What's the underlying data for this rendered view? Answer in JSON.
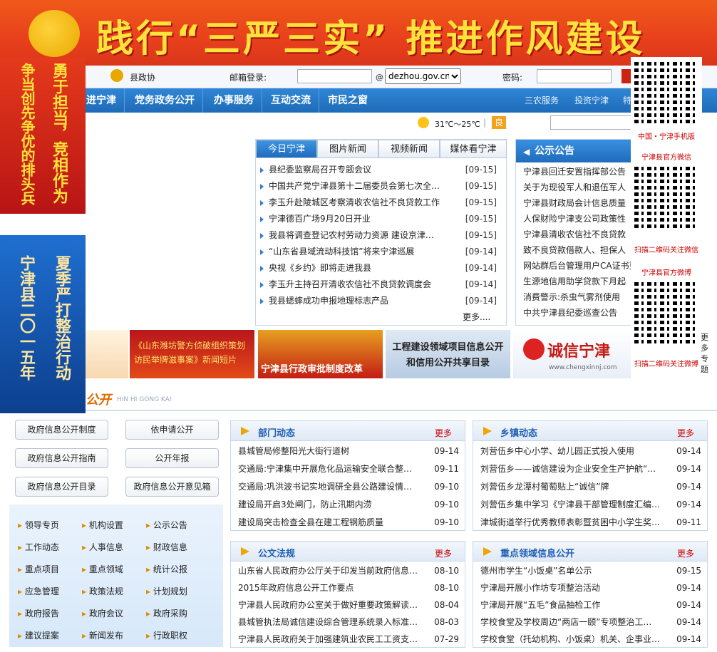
{
  "banner": {
    "title": "践行“三严三实” 推进作风建设"
  },
  "login": {
    "link_left": "县政协",
    "email_label": "邮箱登录:",
    "at": "@",
    "domain": "dezhou.gov.cn",
    "password_label": "密码:"
  },
  "nav": {
    "items": [
      "进宁津",
      "党务政务公开",
      "办事服务",
      "互动交流",
      "市民之窗"
    ],
    "right": [
      "三农服务",
      "投资宁津",
      "特"
    ]
  },
  "weather": {
    "temp": "31℃～25℃",
    "sep": "|",
    "quality": "良"
  },
  "left_ads": {
    "ad1_col1": "勇于担当，竞相作为",
    "ad1_col2": "争当创先争优的排头兵",
    "ad2_col1": "夏季严打整治行动",
    "ad2_col2": "宁津县二〇一五年"
  },
  "tabs": [
    "今日宁津",
    "图片新闻",
    "视频新闻",
    "媒体看宁津"
  ],
  "news": [
    {
      "t": "县纪委监察局召开专题会议",
      "d": "[09-15]"
    },
    {
      "t": "中国共产党宁津县第十二届委员会第七次全体…",
      "d": "[09-15]"
    },
    {
      "t": "李玉升赴陵城区考察清收农信社不良贷款工作",
      "d": "[09-15]"
    },
    {
      "t": "宁津德百广场9月20日开业",
      "d": "[09-15]"
    },
    {
      "t": "我县将调查登记农村劳动力资源 建设京津…",
      "d": "[09-15]"
    },
    {
      "t": "“山东省县域流动科技馆”将来宁津巡展",
      "d": "[09-14]"
    },
    {
      "t": "央视《乡约》即将走进我县",
      "d": "[09-14]"
    },
    {
      "t": "李玉升主持召开清收农信社不良贷款调度会",
      "d": "[09-14]"
    },
    {
      "t": "我县蟋蟀成功申报地理标志产品",
      "d": "[09-14]"
    }
  ],
  "news_more": "更多....",
  "notice": {
    "title": "公示公告",
    "items": [
      "宁津县回迁安置指挥部公告",
      "关于为现役军人和退伍军人",
      "宁津县财政局会计信息质量",
      "人保财险宁津支公司政策性",
      "宁津县清收农信社不良贷款",
      "致不良贷款借款人、担保人",
      "网站群后台管理用户CA证书更新",
      "生源地信用助学贷款下月起",
      "消费警示:杀虫气雾剂使用",
      "中共宁津县纪委巡查公告"
    ]
  },
  "qr": {
    "cap1": "中国・宁津手机版",
    "cap2": "宁津县官方微信",
    "cap3": "扫描二维码关注微信",
    "cap4": "宁津县官方微博",
    "cap5": "扫描二维码关注微博"
  },
  "ads": {
    "a1": "《山东潍坊警方侦破组织策划访民举牌滋事案》新闻短片",
    "a2": "宁津县行政审批制度改革",
    "a3": "工程建设领域项目信息公开和信用公开共享目录",
    "a4": "诚信宁津",
    "a4_url": "www.chengxinnj.com",
    "more": "更多专题"
  },
  "gi": {
    "title": "公开",
    "sub": "HIN HI GONG KAI"
  },
  "gbtns": [
    "政府信息公开制度",
    "依申请公开",
    "政府信息公开指南",
    "公开年报",
    "政府信息公开目录",
    "政府信息公开意见箱"
  ],
  "links": [
    "领导专页",
    "机构设置",
    "公示公告",
    "工作动态",
    "人事信息",
    "财政信息",
    "重点项目",
    "重点领域",
    "统计公报",
    "应急管理",
    "政策法规",
    "计划规划",
    "政府报告",
    "政府会议",
    "政府采购",
    "建议提案",
    "新闻发布",
    "行政职权"
  ],
  "panels": [
    {
      "title": "部门动态",
      "more": "更多",
      "rows": [
        {
          "t": "县城管局修整阳光大街行道树",
          "d": "09-14"
        },
        {
          "t": "交通局:宁津集中开展危化品运输安全联合整…",
          "d": "09-11"
        },
        {
          "t": "交通局:巩洪波书记实地调研全县公路建设情…",
          "d": "09-10"
        },
        {
          "t": "建设局开启3处闸门，防止汛期内涝",
          "d": "09-10"
        },
        {
          "t": "建设局突击检查全县在建工程钢筋质量",
          "d": "09-10"
        }
      ]
    },
    {
      "title": "乡镇动态",
      "more": "更多",
      "rows": [
        {
          "t": "刘营伍乡中心小学、幼儿园正式投入使用",
          "d": "09-14"
        },
        {
          "t": "刘营伍乡——诚信建设为企业安全生产护航“…",
          "d": "09-14"
        },
        {
          "t": "刘营伍乡龙潭村葡萄贴上“诚信”牌",
          "d": "09-14"
        },
        {
          "t": "刘营伍乡集中学习《宁津县干部管理制度汇编…",
          "d": "09-14"
        },
        {
          "t": "津城街道举行优秀教师表彰暨贫困中小学生奖…",
          "d": "09-11"
        }
      ]
    },
    {
      "title": "公文法规",
      "more": "更多",
      "rows": [
        {
          "t": "山东省人民政府办公厅关于印发当前政府信息…",
          "d": "08-10"
        },
        {
          "t": "2015年政府信息公开工作要点",
          "d": "08-10"
        },
        {
          "t": "宁津县人民政府办公室关于做好重要政策解读…",
          "d": "08-04"
        },
        {
          "t": "县城管执法局诚信建设综合管理系统录入标准…",
          "d": "08-03"
        },
        {
          "t": "宁津县人民政府关于加强建筑业农民工工资支…",
          "d": "07-29"
        }
      ]
    },
    {
      "title": "重点领域信息公开",
      "more": "更多",
      "rows": [
        {
          "t": "德州市学生“小饭桌”名单公示",
          "d": "09-15"
        },
        {
          "t": "宁津局开展小作坊专项整治活动",
          "d": "09-14"
        },
        {
          "t": "宁津局开展“五毛”食品抽检工作",
          "d": "09-14"
        },
        {
          "t": "学校食堂及学校周边“两店一颐”专项整治工…",
          "d": "09-14"
        },
        {
          "t": "学校食堂（托幼机构、小饭桌）机关、企事业…",
          "d": "09-14"
        }
      ]
    }
  ]
}
